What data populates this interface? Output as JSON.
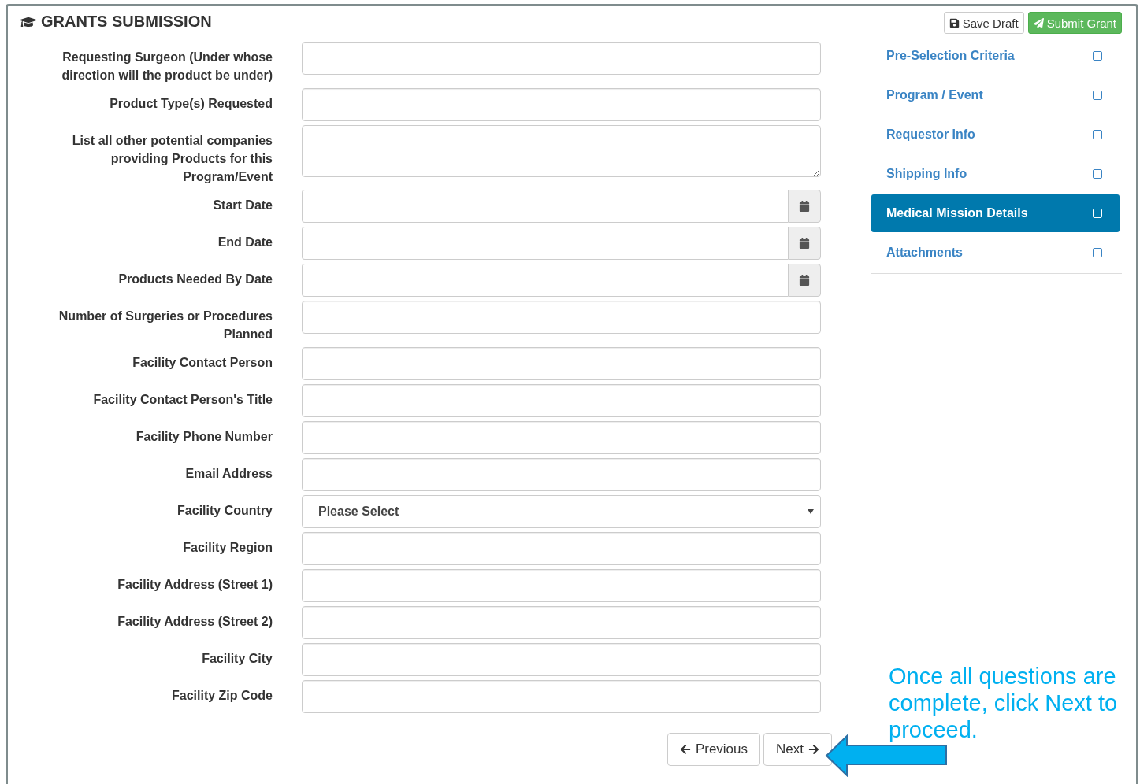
{
  "title": "GRANTS SUBMISSION",
  "actions": [
    {
      "label": "Save Draft",
      "kind": "default"
    },
    {
      "label": "Submit Grant",
      "kind": "primary"
    }
  ],
  "fields": [
    {
      "label": "Requesting Surgeon (Under whose direction will the product be under)",
      "kind": "text"
    },
    {
      "label": "Product Type(s) Requested",
      "kind": "text"
    },
    {
      "label": "List all other potential companies providing Products for this Program/Event",
      "kind": "textarea"
    },
    {
      "label": "Start Date",
      "kind": "date"
    },
    {
      "label": "End Date",
      "kind": "date"
    },
    {
      "label": "Products Needed By Date",
      "kind": "date"
    },
    {
      "label": "Number of Surgeries or Procedures Planned",
      "kind": "text"
    },
    {
      "label": "Facility Contact Person",
      "kind": "text"
    },
    {
      "label": "Facility Contact Person's Title",
      "kind": "text"
    },
    {
      "label": "Facility Phone Number",
      "kind": "text"
    },
    {
      "label": "Email Address",
      "kind": "text"
    },
    {
      "label": "Facility Country",
      "kind": "select",
      "value": "Please Select"
    },
    {
      "label": "Facility Region",
      "kind": "text"
    },
    {
      "label": "Facility Address (Street 1)",
      "kind": "text"
    },
    {
      "label": "Facility Address (Street 2)",
      "kind": "text"
    },
    {
      "label": "Facility City",
      "kind": "text"
    },
    {
      "label": "Facility Zip Code",
      "kind": "text"
    }
  ],
  "steps": [
    {
      "label": "Pre-Selection Criteria",
      "selected": false,
      "checked": false
    },
    {
      "label": "Program / Event",
      "selected": false,
      "checked": false
    },
    {
      "label": "Requestor Info",
      "selected": false,
      "checked": false
    },
    {
      "label": "Shipping Info",
      "selected": false,
      "checked": false
    },
    {
      "label": "Medical Mission Details",
      "selected": true,
      "checked": false
    },
    {
      "label": "Attachments",
      "selected": false,
      "checked": false
    }
  ],
  "pager": [
    {
      "label": "Previous",
      "kind": "previous"
    },
    {
      "label": "Next",
      "kind": "next"
    }
  ],
  "note": "Once all questions are complete, click Next to proceed."
}
